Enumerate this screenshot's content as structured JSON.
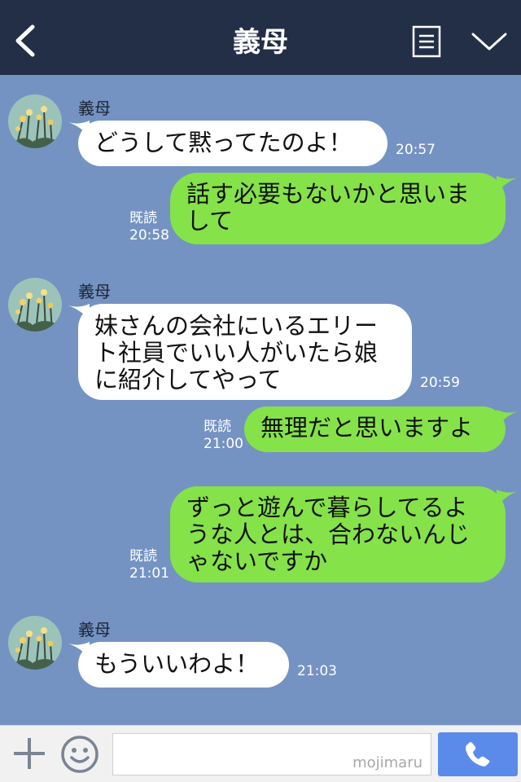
{
  "header": {
    "title": "義母",
    "back_icon": "chevron-left-icon",
    "menu_icon": "document-menu-icon",
    "collapse_icon": "chevron-down-icon"
  },
  "messages": [
    {
      "from": "义母",
      "sender": "義母",
      "text": "どうして黙ってたのよ！",
      "time": "20:57"
    },
    {
      "from": "me",
      "read_label": "既読",
      "time": "20:58",
      "text": "話す必要もないかと思いま\nして"
    },
    {
      "from": "义母",
      "sender": "義母",
      "text": "妹さんの会社にいるエリー\nト社員でいい人がいたら娘\nに紹介してやって",
      "time": "20:59"
    },
    {
      "from": "me",
      "read_label": "既読",
      "time": "21:00",
      "text": "無理だと思いますよ"
    },
    {
      "from": "me",
      "read_label": "既読",
      "time": "21:01",
      "text": "ずっと遊んで暮らしてるよ\nうな人とは、合わないんじ\nゃないですか"
    },
    {
      "from": "义母",
      "sender": "義母",
      "text": "もういいわよ！",
      "time": "21:03"
    }
  ],
  "input_bar": {
    "watermark": "mojimaru",
    "plus_icon": "plus-icon",
    "emoji_icon": "smiley-icon",
    "call_icon": "phone-icon"
  },
  "colors": {
    "header_bg": "#232e47",
    "chat_bg": "#7493c3",
    "outgoing_bubble": "#85e249",
    "incoming_bubble": "#ffffff",
    "call_button": "#5a8bea"
  }
}
